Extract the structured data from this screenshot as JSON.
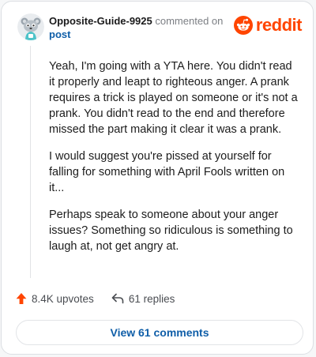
{
  "header": {
    "username": "Opposite-Guide-9925",
    "action_text": "commented on",
    "post_link": "post"
  },
  "brand": {
    "logo_text": "reddit",
    "logo_icon": "reddit-alien-icon",
    "color": "#ff4500"
  },
  "avatar": {
    "icon": "snoo-avatar-icon"
  },
  "comment": {
    "paragraphs": [
      "Yeah, I'm going with a YTA here. You didn't read it properly and leapt to righteous anger. A prank requires a trick is played on someone or it's not a prank. You didn't read to the end and therefore missed the part making it clear it was a prank.",
      "I would suggest you're pissed at yourself for falling for something with April Fools written on it...",
      "Perhaps speak to someone about your anger issues? Something so ridiculous is something to laugh at, not get angry at."
    ]
  },
  "stats": {
    "upvotes": "8.4K upvotes",
    "upvote_icon": "upvote-arrow-icon",
    "replies": "61 replies",
    "reply_icon": "reply-arrow-icon"
  },
  "footer": {
    "view_comments": "View 61 comments"
  },
  "colors": {
    "upvote": "#ff4500",
    "link": "#0f5ea8"
  }
}
